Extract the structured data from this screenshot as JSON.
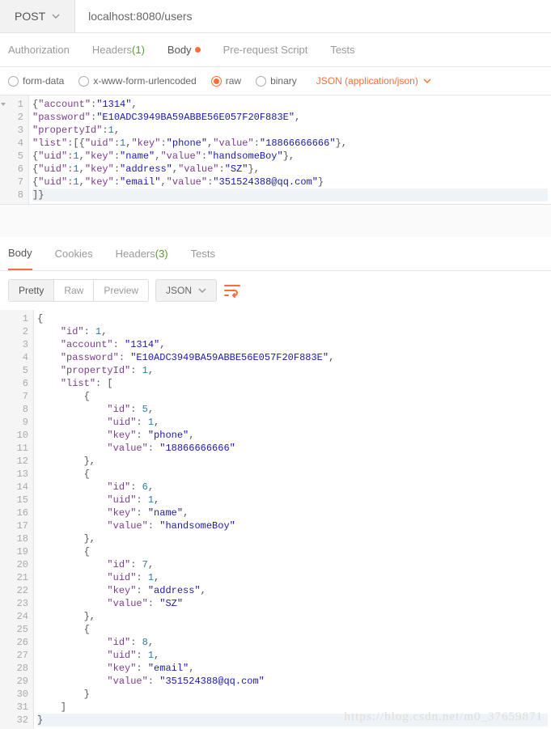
{
  "request": {
    "method": "POST",
    "url": "localhost:8080/users"
  },
  "tabs": {
    "auth": "Authorization",
    "headers": "Headers",
    "headers_count": "(1)",
    "body": "Body",
    "prereq": "Pre-request Script",
    "tests": "Tests"
  },
  "body_types": {
    "formdata": "form-data",
    "urlencoded": "x-www-form-urlencoded",
    "raw": "raw",
    "binary": "binary",
    "content_type": "JSON (application/json)"
  },
  "request_body_lines": [
    [
      [
        "p",
        "{"
      ],
      [
        "k",
        "\"account\""
      ],
      [
        "p",
        ":"
      ],
      [
        "s",
        "\"1314\""
      ],
      [
        "p",
        ","
      ]
    ],
    [
      [
        "k",
        "\"password\""
      ],
      [
        "p",
        ":"
      ],
      [
        "s",
        "\"E10ADC3949BA59ABBE56E057F20F883E\""
      ],
      [
        "p",
        ","
      ]
    ],
    [
      [
        "k",
        "\"propertyId\""
      ],
      [
        "p",
        ":"
      ],
      [
        "n",
        "1"
      ],
      [
        "p",
        ","
      ]
    ],
    [
      [
        "k",
        "\"list\""
      ],
      [
        "p",
        ":[{"
      ],
      [
        "k",
        "\"uid\""
      ],
      [
        "p",
        ":"
      ],
      [
        "n",
        "1"
      ],
      [
        "p",
        ","
      ],
      [
        "k",
        "\"key\""
      ],
      [
        "p",
        ":"
      ],
      [
        "s",
        "\"phone\""
      ],
      [
        "p",
        ","
      ],
      [
        "k",
        "\"value\""
      ],
      [
        "p",
        ":"
      ],
      [
        "s",
        "\"18866666666\""
      ],
      [
        "p",
        "},"
      ]
    ],
    [
      [
        "p",
        "{"
      ],
      [
        "k",
        "\"uid\""
      ],
      [
        "p",
        ":"
      ],
      [
        "n",
        "1"
      ],
      [
        "p",
        ","
      ],
      [
        "k",
        "\"key\""
      ],
      [
        "p",
        ":"
      ],
      [
        "s",
        "\"name\""
      ],
      [
        "p",
        ","
      ],
      [
        "k",
        "\"value\""
      ],
      [
        "p",
        ":"
      ],
      [
        "s",
        "\"handsomeBoy\""
      ],
      [
        "p",
        "},"
      ]
    ],
    [
      [
        "p",
        "{"
      ],
      [
        "k",
        "\"uid\""
      ],
      [
        "p",
        ":"
      ],
      [
        "n",
        "1"
      ],
      [
        "p",
        ","
      ],
      [
        "k",
        "\"key\""
      ],
      [
        "p",
        ":"
      ],
      [
        "s",
        "\"address\""
      ],
      [
        "p",
        ","
      ],
      [
        "k",
        "\"value\""
      ],
      [
        "p",
        ":"
      ],
      [
        "s",
        "\"SZ\""
      ],
      [
        "p",
        "},"
      ]
    ],
    [
      [
        "p",
        "{"
      ],
      [
        "k",
        "\"uid\""
      ],
      [
        "p",
        ":"
      ],
      [
        "n",
        "1"
      ],
      [
        "p",
        ","
      ],
      [
        "k",
        "\"key\""
      ],
      [
        "p",
        ":"
      ],
      [
        "s",
        "\"email\""
      ],
      [
        "p",
        ","
      ],
      [
        "k",
        "\"value\""
      ],
      [
        "p",
        ":"
      ],
      [
        "s",
        "\"351524388@qq.com\""
      ],
      [
        "p",
        "}"
      ]
    ],
    [
      [
        "p",
        "]}"
      ]
    ]
  ],
  "response_tabs": {
    "body": "Body",
    "cookies": "Cookies",
    "headers": "Headers",
    "headers_count": "(3)",
    "tests": "Tests"
  },
  "view_modes": {
    "pretty": "Pretty",
    "raw": "Raw",
    "preview": "Preview"
  },
  "response_format": "JSON",
  "response_lines": [
    {
      "fold": true,
      "t": [
        [
          "p",
          "{"
        ]
      ]
    },
    {
      "t": [
        [
          "p",
          "    "
        ],
        [
          "k",
          "\"id\""
        ],
        [
          "p",
          ": "
        ],
        [
          "n",
          "1"
        ],
        [
          "p",
          ","
        ]
      ]
    },
    {
      "t": [
        [
          "p",
          "    "
        ],
        [
          "k",
          "\"account\""
        ],
        [
          "p",
          ": "
        ],
        [
          "s",
          "\"1314\""
        ],
        [
          "p",
          ","
        ]
      ]
    },
    {
      "t": [
        [
          "p",
          "    "
        ],
        [
          "k",
          "\"password\""
        ],
        [
          "p",
          ": "
        ],
        [
          "s",
          "\"E10ADC3949BA59ABBE56E057F20F883E\""
        ],
        [
          "p",
          ","
        ]
      ]
    },
    {
      "t": [
        [
          "p",
          "    "
        ],
        [
          "k",
          "\"propertyId\""
        ],
        [
          "p",
          ": "
        ],
        [
          "n",
          "1"
        ],
        [
          "p",
          ","
        ]
      ]
    },
    {
      "fold": true,
      "t": [
        [
          "p",
          "    "
        ],
        [
          "k",
          "\"list\""
        ],
        [
          "p",
          ": ["
        ]
      ]
    },
    {
      "fold": true,
      "t": [
        [
          "p",
          "        {"
        ]
      ]
    },
    {
      "t": [
        [
          "p",
          "            "
        ],
        [
          "k",
          "\"id\""
        ],
        [
          "p",
          ": "
        ],
        [
          "n",
          "5"
        ],
        [
          "p",
          ","
        ]
      ]
    },
    {
      "t": [
        [
          "p",
          "            "
        ],
        [
          "k",
          "\"uid\""
        ],
        [
          "p",
          ": "
        ],
        [
          "n",
          "1"
        ],
        [
          "p",
          ","
        ]
      ]
    },
    {
      "t": [
        [
          "p",
          "            "
        ],
        [
          "k",
          "\"key\""
        ],
        [
          "p",
          ": "
        ],
        [
          "s",
          "\"phone\""
        ],
        [
          "p",
          ","
        ]
      ]
    },
    {
      "t": [
        [
          "p",
          "            "
        ],
        [
          "k",
          "\"value\""
        ],
        [
          "p",
          ": "
        ],
        [
          "s",
          "\"18866666666\""
        ]
      ]
    },
    {
      "t": [
        [
          "p",
          "        },"
        ]
      ]
    },
    {
      "fold": true,
      "t": [
        [
          "p",
          "        {"
        ]
      ]
    },
    {
      "t": [
        [
          "p",
          "            "
        ],
        [
          "k",
          "\"id\""
        ],
        [
          "p",
          ": "
        ],
        [
          "n",
          "6"
        ],
        [
          "p",
          ","
        ]
      ]
    },
    {
      "t": [
        [
          "p",
          "            "
        ],
        [
          "k",
          "\"uid\""
        ],
        [
          "p",
          ": "
        ],
        [
          "n",
          "1"
        ],
        [
          "p",
          ","
        ]
      ]
    },
    {
      "t": [
        [
          "p",
          "            "
        ],
        [
          "k",
          "\"key\""
        ],
        [
          "p",
          ": "
        ],
        [
          "s",
          "\"name\""
        ],
        [
          "p",
          ","
        ]
      ]
    },
    {
      "t": [
        [
          "p",
          "            "
        ],
        [
          "k",
          "\"value\""
        ],
        [
          "p",
          ": "
        ],
        [
          "s",
          "\"handsomeBoy\""
        ]
      ]
    },
    {
      "t": [
        [
          "p",
          "        },"
        ]
      ]
    },
    {
      "fold": true,
      "t": [
        [
          "p",
          "        {"
        ]
      ]
    },
    {
      "t": [
        [
          "p",
          "            "
        ],
        [
          "k",
          "\"id\""
        ],
        [
          "p",
          ": "
        ],
        [
          "n",
          "7"
        ],
        [
          "p",
          ","
        ]
      ]
    },
    {
      "t": [
        [
          "p",
          "            "
        ],
        [
          "k",
          "\"uid\""
        ],
        [
          "p",
          ": "
        ],
        [
          "n",
          "1"
        ],
        [
          "p",
          ","
        ]
      ]
    },
    {
      "t": [
        [
          "p",
          "            "
        ],
        [
          "k",
          "\"key\""
        ],
        [
          "p",
          ": "
        ],
        [
          "s",
          "\"address\""
        ],
        [
          "p",
          ","
        ]
      ]
    },
    {
      "t": [
        [
          "p",
          "            "
        ],
        [
          "k",
          "\"value\""
        ],
        [
          "p",
          ": "
        ],
        [
          "s",
          "\"SZ\""
        ]
      ]
    },
    {
      "t": [
        [
          "p",
          "        },"
        ]
      ]
    },
    {
      "fold": true,
      "t": [
        [
          "p",
          "        {"
        ]
      ]
    },
    {
      "t": [
        [
          "p",
          "            "
        ],
        [
          "k",
          "\"id\""
        ],
        [
          "p",
          ": "
        ],
        [
          "n",
          "8"
        ],
        [
          "p",
          ","
        ]
      ]
    },
    {
      "t": [
        [
          "p",
          "            "
        ],
        [
          "k",
          "\"uid\""
        ],
        [
          "p",
          ": "
        ],
        [
          "n",
          "1"
        ],
        [
          "p",
          ","
        ]
      ]
    },
    {
      "t": [
        [
          "p",
          "            "
        ],
        [
          "k",
          "\"key\""
        ],
        [
          "p",
          ": "
        ],
        [
          "s",
          "\"email\""
        ],
        [
          "p",
          ","
        ]
      ]
    },
    {
      "t": [
        [
          "p",
          "            "
        ],
        [
          "k",
          "\"value\""
        ],
        [
          "p",
          ": "
        ],
        [
          "s",
          "\"351524388@qq.com\""
        ]
      ]
    },
    {
      "t": [
        [
          "p",
          "        }"
        ]
      ]
    },
    {
      "t": [
        [
          "p",
          "    ]"
        ]
      ]
    },
    {
      "t": [
        [
          "p",
          "}"
        ]
      ]
    }
  ],
  "watermark": "https://blog.csdn.net/m0_37659871"
}
